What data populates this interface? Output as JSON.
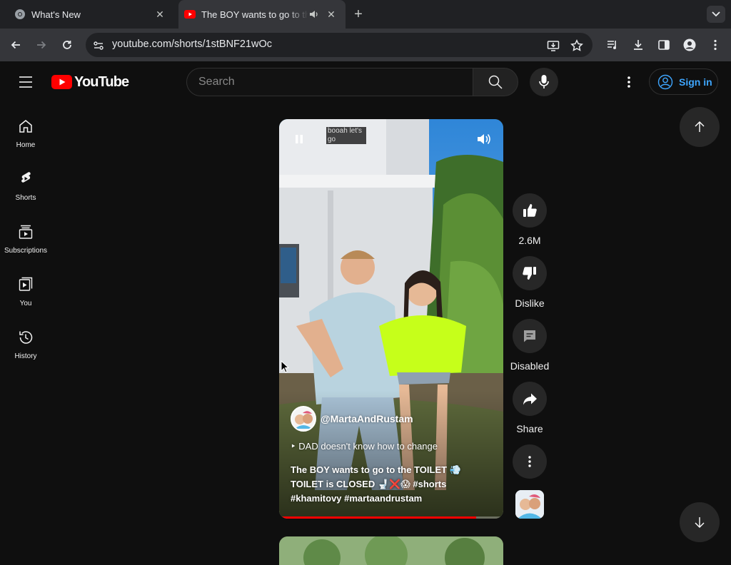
{
  "browser": {
    "tabs": [
      {
        "title": "What's New",
        "active": false
      },
      {
        "title": "The BOY wants to go to the",
        "active": true
      }
    ],
    "address": "youtube.com/shorts/1stBNF21wOc"
  },
  "masthead": {
    "logo_text": "YouTube",
    "search_placeholder": "Search",
    "sign_in_label": "Sign in"
  },
  "sidebar": {
    "items": [
      {
        "label": "Home",
        "icon": "home-icon"
      },
      {
        "label": "Shorts",
        "icon": "shorts-icon"
      },
      {
        "label": "Subscriptions",
        "icon": "subscriptions-icon"
      },
      {
        "label": "You",
        "icon": "you-icon"
      },
      {
        "label": "History",
        "icon": "history-icon"
      }
    ]
  },
  "short": {
    "caption_overlay": "booah let's go",
    "channel_handle": "@MartaAndRustam",
    "playlist_title": "DAD doesn't know how to change",
    "description_line1": "The BOY wants to go to the TOILET 💨",
    "description_line2": "TOILET is CLOSED 🚽❌😱 #shorts",
    "description_line3": "#khamitovy #martaandrustam",
    "progress_fraction": 0.88
  },
  "actions": {
    "like_count": "2.6M",
    "dislike_label": "Dislike",
    "comments_label": "Disabled",
    "share_label": "Share"
  },
  "colors": {
    "accent_red": "#ff0000",
    "link_blue": "#3ea6ff",
    "background": "#0f0f0f"
  }
}
